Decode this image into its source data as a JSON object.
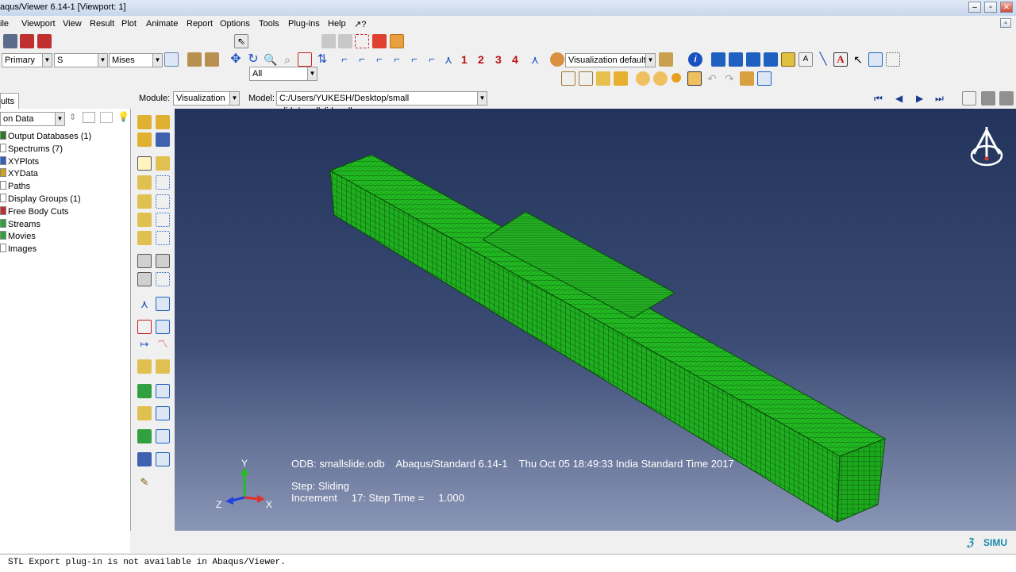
{
  "window": {
    "title": "aqus/Viewer 6.14-1 [Viewport: 1]"
  },
  "menu": [
    "ile",
    "Viewport",
    "View",
    "Result",
    "Plot",
    "Animate",
    "Report",
    "Options",
    "Tools",
    "Plug-ins",
    "Help",
    "↗?"
  ],
  "toolbar": {
    "selection_filter": "All",
    "primary_select": "Primary",
    "variable_select": "S",
    "invariant_select": "Mises",
    "view_numbers": [
      "1",
      "2",
      "3",
      "4"
    ],
    "visualization_defaults": "Visualization defaults"
  },
  "context": {
    "module_label": "Module:",
    "module_value": "Visualization",
    "model_label": "Model:",
    "model_value": "C:/Users/YUKESH/Desktop/small slide/smallslide.odb"
  },
  "left_panel": {
    "tab_label": "ults",
    "filter_value": "on Data",
    "tree_items": [
      {
        "label": "Output Databases (1)",
        "color": "#2a7a2a"
      },
      {
        "label": "Spectrums (7)",
        "color": "#ffffff"
      },
      {
        "label": "XYPlots",
        "color": "#3060c0"
      },
      {
        "label": "XYData",
        "color": "#d0a020"
      },
      {
        "label": "Paths",
        "color": "#ffffff"
      },
      {
        "label": "Display Groups (1)",
        "color": "#ffffff"
      },
      {
        "label": "Free Body Cuts",
        "color": "#c03030"
      },
      {
        "label": "Streams",
        "color": "#30a040"
      },
      {
        "label": "Movies",
        "color": "#30a040"
      },
      {
        "label": "Images",
        "color": "#ffffff"
      }
    ]
  },
  "viewport": {
    "axis_y": "Y",
    "axis_z": "Z",
    "axis_x": "X",
    "odb_line": "ODB: smallslide.odb    Abaqus/Standard 6.14-1    Thu Oct 05 18:49:33 India Standard Time 2017",
    "step_line": "Step: Sliding",
    "increment_line": "Increment     17: Step Time =     1.000",
    "mesh_color": "#1fb31f",
    "brand_text": "SIMU"
  },
  "status": {
    "message": "STL Export plug-in is not available in Abaqus/Viewer."
  }
}
